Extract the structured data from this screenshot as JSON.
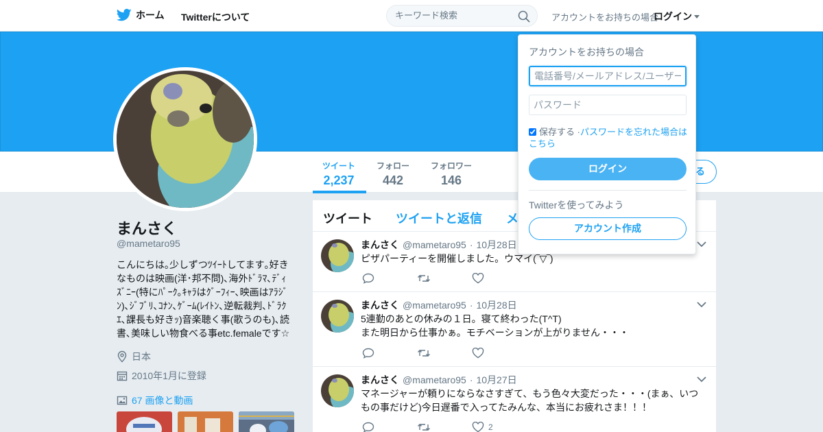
{
  "nav": {
    "home_label": "ホーム",
    "about_label": "Twitterについて",
    "search_placeholder": "キーワード検索",
    "login_prompt": "アカウントをお持ちの場合",
    "login_label": "ログイン"
  },
  "profile": {
    "name": "まんさく",
    "handle": "@mametaro95",
    "bio": "こんにちは｡少しずつﾂｲｰﾄしてます｡好きなものは映画(洋･邦不問)､海外ﾄﾞﾗﾏ､ﾃﾞｨｽﾞﾆｰ(特にﾊﾟｰｸ｡ｷｬﾗはｸﾞｰﾌｨｰ､映画はｱﾗｼﾞﾝ)､ｼﾞﾌﾞﾘ､ｺﾅﾝ､ｹﾞｰﾑ(ﾚｲﾄﾝ､逆転裁判､ﾄﾞﾗｸｴ､課長も好きｯ)音楽聴く事(歌うのも)､読書､美味しい物食べる事etc.femaleです☆",
    "location": "日本",
    "joined": "2010年1月に登録",
    "media_link": "67 画像と動画"
  },
  "stats": [
    {
      "label": "ツイート",
      "value": "2,237"
    },
    {
      "label": "フォロー",
      "value": "442"
    },
    {
      "label": "フォロワー",
      "value": "146"
    }
  ],
  "follow_partial_label": "る",
  "timeline": {
    "tabs": [
      "ツイート",
      "ツイートと返信",
      "メ"
    ],
    "tweets": [
      {
        "name": "まんさく",
        "handle": "@mametaro95",
        "time": "10月28日",
        "text": "ピザパーティーを開催しました。ウマイ(‾▽‾)",
        "likes": ""
      },
      {
        "name": "まんさく",
        "handle": "@mametaro95",
        "time": "10月28日",
        "text": "5連勤のあとの休みの１日。寝て終わった(T^T)\nまた明日から仕事かぁ。モチベーションが上がりません・・・",
        "likes": ""
      },
      {
        "name": "まんさく",
        "handle": "@mametaro95",
        "time": "10月27日",
        "text": "マネージャーが頼りにならなさすぎて、もう色々大変だった・・・(まぁ、いつもの事だけど)今日遅番で入ってたみんな、本当にお疲れさま！！！",
        "likes": "2"
      }
    ]
  },
  "dropdown": {
    "title": "アカウントをお持ちの場合",
    "username_placeholder": "電話番号/メールアドレス/ユーザー名",
    "password_placeholder": "パスワード",
    "remember_label": "保存する",
    "separator": "·",
    "forgot_link": "パスワードを忘れた場合はこちら",
    "login_button": "ログイン",
    "try_label": "Twitterを使ってみよう",
    "signup_button": "アカウント作成"
  },
  "colors": {
    "brand": "#1da1f2",
    "banner": "#1da1f2",
    "background": "#e6ecf0"
  }
}
